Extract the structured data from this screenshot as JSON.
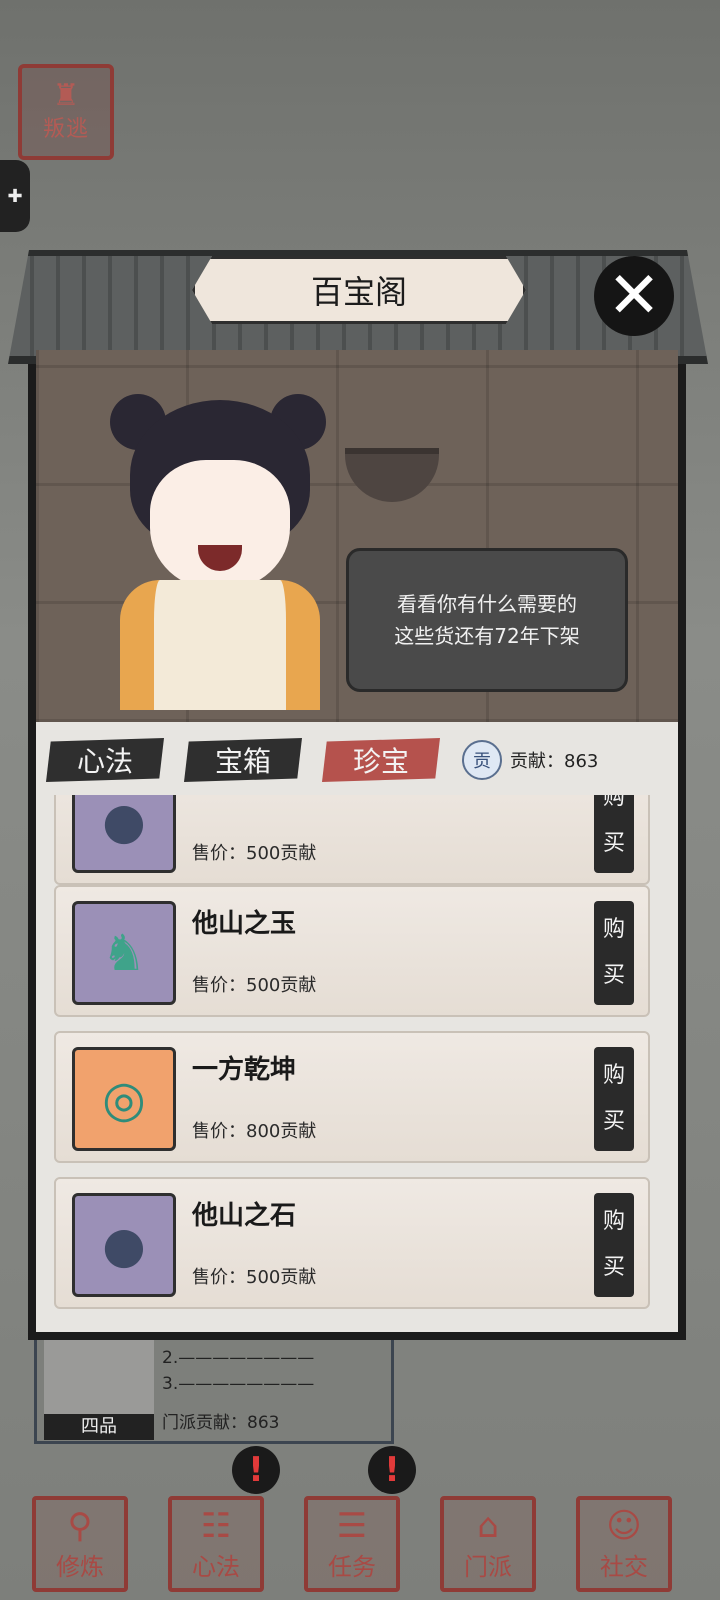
{
  "left_badge": {
    "label": "叛逃"
  },
  "side_tab": {
    "icon": "puzzle-icon"
  },
  "shop": {
    "title": "百宝阁",
    "speech_lines": [
      "看看你有什么需要的",
      "这些货还有72年下架"
    ],
    "tabs": [
      "心法",
      "宝箱",
      "珍宝"
    ],
    "active_tab": "珍宝",
    "contribution_label": "贡献：863",
    "contribution_badge": "贡",
    "items": [
      {
        "name": "",
        "price": "售价：500贡献",
        "buy": [
          "购",
          "买"
        ],
        "icon": "stone-icon",
        "frame": "purple"
      },
      {
        "name": "他山之玉",
        "price": "售价：500贡献",
        "buy": [
          "购",
          "买"
        ],
        "icon": "jade-beast-icon",
        "frame": "purple"
      },
      {
        "name": "一方乾坤",
        "price": "售价：800贡献",
        "buy": [
          "购",
          "买"
        ],
        "icon": "jade-ring-icon",
        "frame": "orange"
      },
      {
        "name": "他山之石",
        "price": "售价：500贡献",
        "buy": [
          "购",
          "买"
        ],
        "icon": "stone-icon",
        "frame": "purple"
      }
    ]
  },
  "status": {
    "rank": "四品",
    "row2": "2.————————",
    "row3": "3.————————",
    "contribution": "门派贡献：863"
  },
  "nav": [
    {
      "label": "修炼",
      "icon": "practice-icon"
    },
    {
      "label": "心法",
      "icon": "scroll-icon"
    },
    {
      "label": "任务",
      "icon": "task-icon"
    },
    {
      "label": "门派",
      "icon": "sect-icon"
    },
    {
      "label": "社交",
      "icon": "social-icon"
    }
  ],
  "alerts": [
    "!",
    "!"
  ],
  "colors": {
    "active_tab": "#b5524d",
    "seal": "#8f3b36",
    "alert": "#e23a3a"
  }
}
